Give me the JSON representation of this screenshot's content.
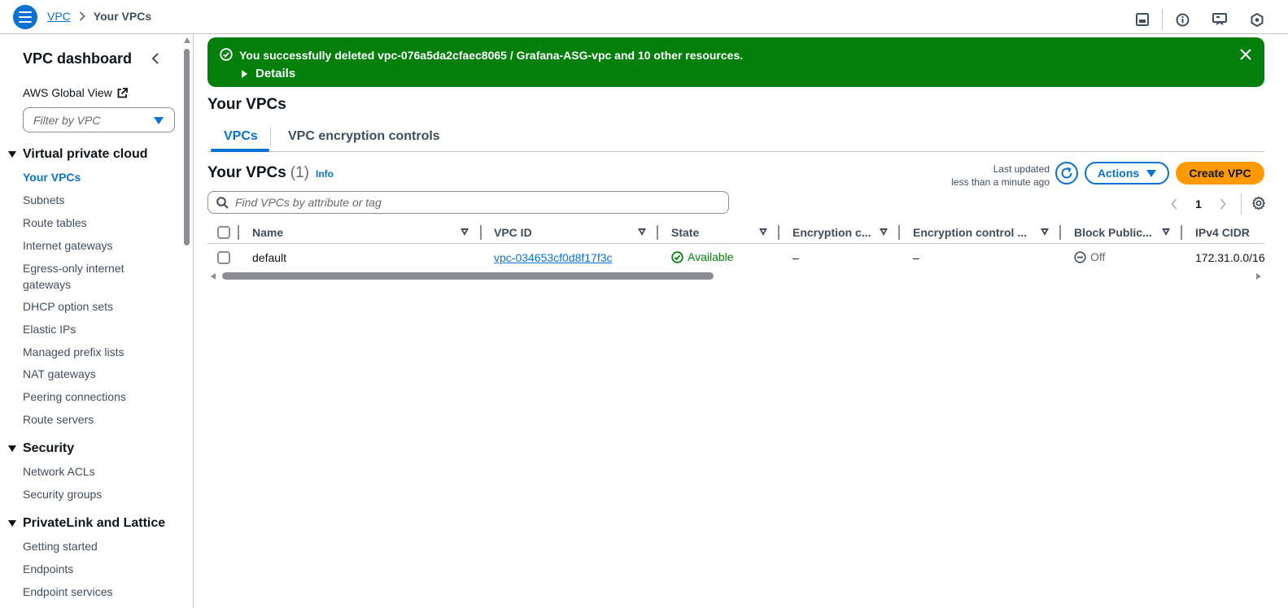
{
  "breadcrumb": {
    "root": "VPC",
    "current": "Your VPCs"
  },
  "sidebar": {
    "title": "VPC dashboard",
    "global_view": "AWS Global View",
    "filter_placeholder": "Filter by VPC",
    "sections": [
      {
        "title": "Virtual private cloud",
        "items": [
          "Your VPCs",
          "Subnets",
          "Route tables",
          "Internet gateways",
          "Egress-only internet gateways",
          "DHCP option sets",
          "Elastic IPs",
          "Managed prefix lists",
          "NAT gateways",
          "Peering connections",
          "Route servers"
        ]
      },
      {
        "title": "Security",
        "items": [
          "Network ACLs",
          "Security groups"
        ]
      },
      {
        "title": "PrivateLink and Lattice",
        "items": [
          "Getting started",
          "Endpoints",
          "Endpoint services"
        ]
      }
    ],
    "active_item": "Your VPCs"
  },
  "flash": {
    "message": "You successfully deleted vpc-076a5da2cfaec8065 / Grafana-ASG-vpc and 10 other resources.",
    "details_label": "Details",
    "color": "#037f0c"
  },
  "page": {
    "title": "Your VPCs"
  },
  "tabs": [
    {
      "label": "VPCs",
      "active": true
    },
    {
      "label": "VPC encryption controls",
      "active": false
    }
  ],
  "table": {
    "title": "Your VPCs",
    "count": "(1)",
    "info_label": "Info",
    "last_updated_line1": "Last updated",
    "last_updated_line2": "less than a minute ago",
    "actions_label": "Actions",
    "create_label": "Create VPC",
    "search_placeholder": "Find VPCs by attribute or tag",
    "page_number": "1",
    "columns": [
      "Name",
      "VPC ID",
      "State",
      "Encryption c...",
      "Encryption control ...",
      "Block Public...",
      "IPv4 CIDR"
    ],
    "rows": [
      {
        "name": "default",
        "vpc_id": "vpc-034653cf0d8f17f3c",
        "state": "Available",
        "enc_c": "–",
        "enc_control": "–",
        "block_public": "Off",
        "ipv4_cidr": "172.31.0.0/16"
      }
    ]
  },
  "colors": {
    "accent": "#0972d3",
    "primary_button": "#ff9900",
    "success": "#037f0c"
  }
}
